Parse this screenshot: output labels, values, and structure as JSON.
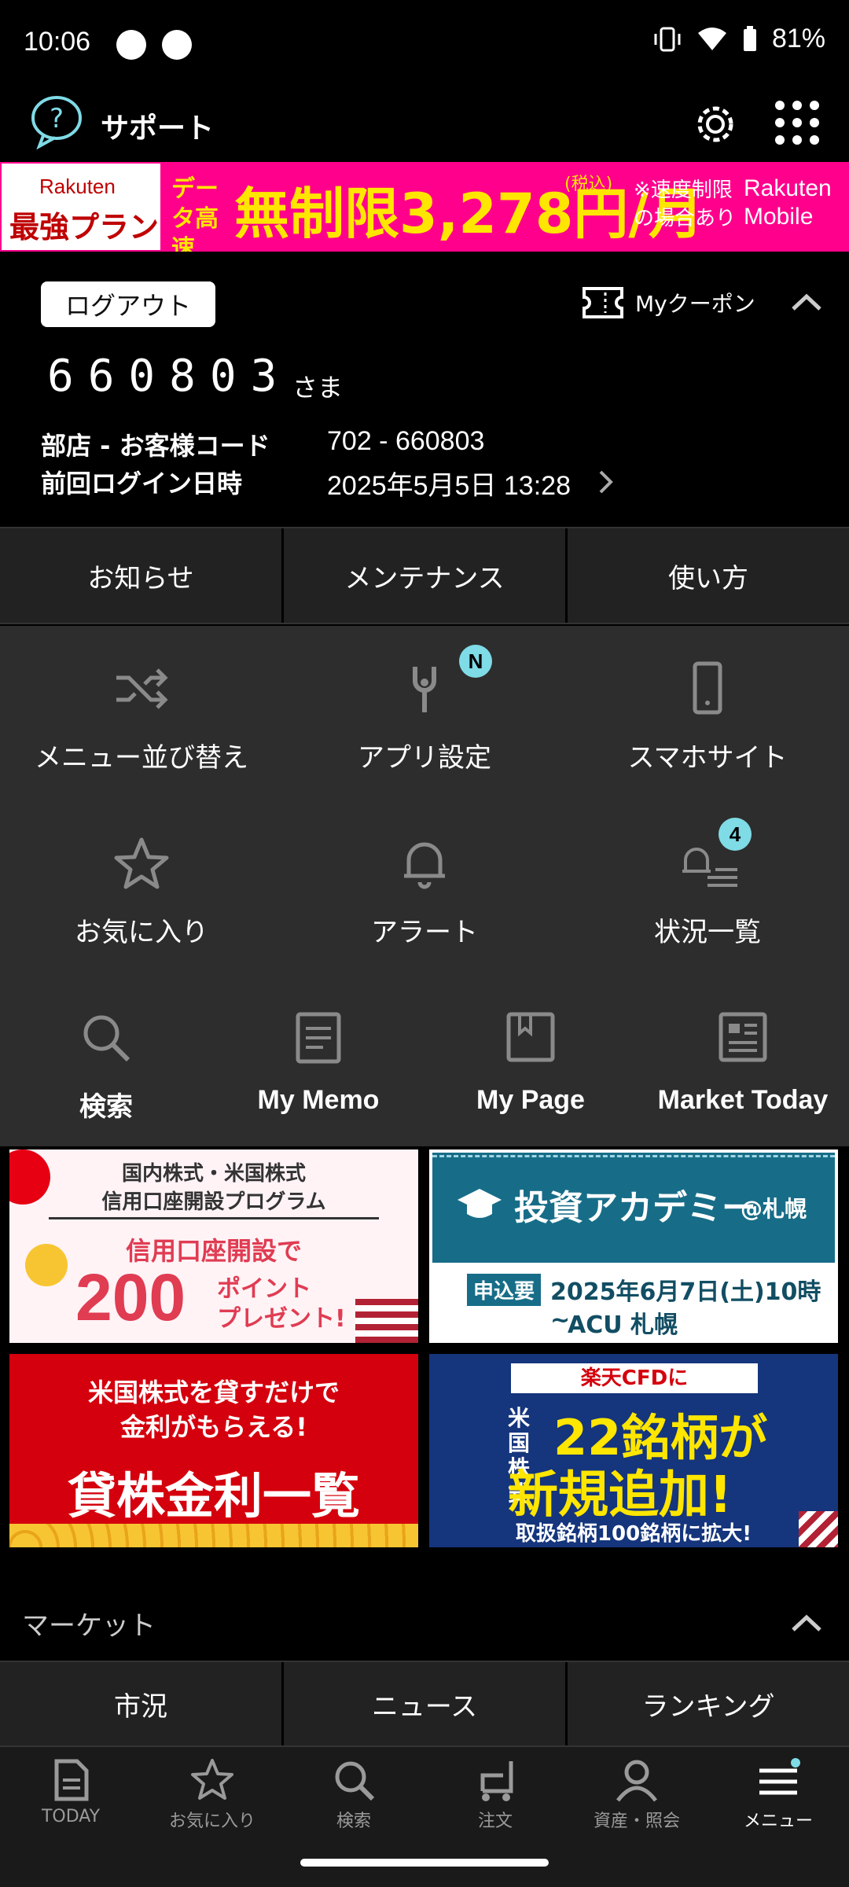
{
  "status_bar": {
    "time": "10:06",
    "battery": "81%"
  },
  "header": {
    "support_label": "サポート"
  },
  "banner": {
    "brand_top": "Rakuten",
    "plan": "最強プラン",
    "tag": "データ高速",
    "main_text": "無制限3,278円/月",
    "tax": "(税込)",
    "note": "※速度制限の場合あり",
    "mobile_brand": "Rakuten Mobile"
  },
  "account": {
    "logout_label": "ログアウト",
    "coupon_label": "Myクーポン",
    "user_name": "660803",
    "honorific": "さま",
    "branch_label": "部店 - お客様コード",
    "branch_value": "702 - 660803",
    "last_login_label": "前回ログイン日時",
    "last_login_value": "2025年5月5日 13:28"
  },
  "info_tabs": [
    "お知らせ",
    "メンテナンス",
    "使い方"
  ],
  "menu": {
    "row1": [
      {
        "label": "メニュー並び替え",
        "icon": "shuffle-icon"
      },
      {
        "label": "アプリ設定",
        "icon": "wrench-icon",
        "badge": "N"
      },
      {
        "label": "スマホサイト",
        "icon": "phone-icon"
      }
    ],
    "row2": [
      {
        "label": "お気に入り",
        "icon": "star-icon"
      },
      {
        "label": "アラート",
        "icon": "bell-icon"
      },
      {
        "label": "状況一覧",
        "icon": "bell-list-icon",
        "badge": "4"
      }
    ],
    "row3": [
      {
        "label": "検索",
        "icon": "search-icon"
      },
      {
        "label": "My Memo",
        "icon": "memo-icon"
      },
      {
        "label": "My Page",
        "icon": "bookmark-icon"
      },
      {
        "label": "Market Today",
        "icon": "news-icon"
      }
    ]
  },
  "promos": {
    "p1": {
      "line1": "国内株式・米国株式",
      "line2": "信用口座開設プログラム",
      "line3": "信用口座開設で",
      "big": "200",
      "line4": "ポイント",
      "line5": "プレゼント!"
    },
    "p2": {
      "title": "投資アカデミー",
      "at": "@札幌",
      "apply": "申込要",
      "date": "2025年6月7日(土)10時~",
      "place": "ACU 札幌"
    },
    "p3": {
      "line1": "米国株式を貸すだけで",
      "line2": "金利がもらえる!",
      "big": "貸株金利一覧"
    },
    "p4": {
      "tag": "楽天CFDに",
      "prefix": "米国株式",
      "big1": "22銘柄が",
      "big2": "新規追加!",
      "note": "取扱銘柄100銘柄に拡大!"
    }
  },
  "market": {
    "title": "マーケット",
    "tabs": [
      "市況",
      "ニュース",
      "ランキング"
    ]
  },
  "bottom_nav": [
    {
      "label": "TODAY",
      "icon": "today-icon"
    },
    {
      "label": "お気に入り",
      "icon": "star-icon"
    },
    {
      "label": "検索",
      "icon": "search-icon"
    },
    {
      "label": "注文",
      "icon": "cart-icon"
    },
    {
      "label": "資産・照会",
      "icon": "person-icon"
    },
    {
      "label": "メニュー",
      "icon": "menu-icon"
    }
  ],
  "colors": {
    "badge": "#7fdbe6",
    "banner_pink": "#ff008c",
    "banner_yellow": "#ffe600",
    "menu_bg": "#2d2d2d"
  }
}
